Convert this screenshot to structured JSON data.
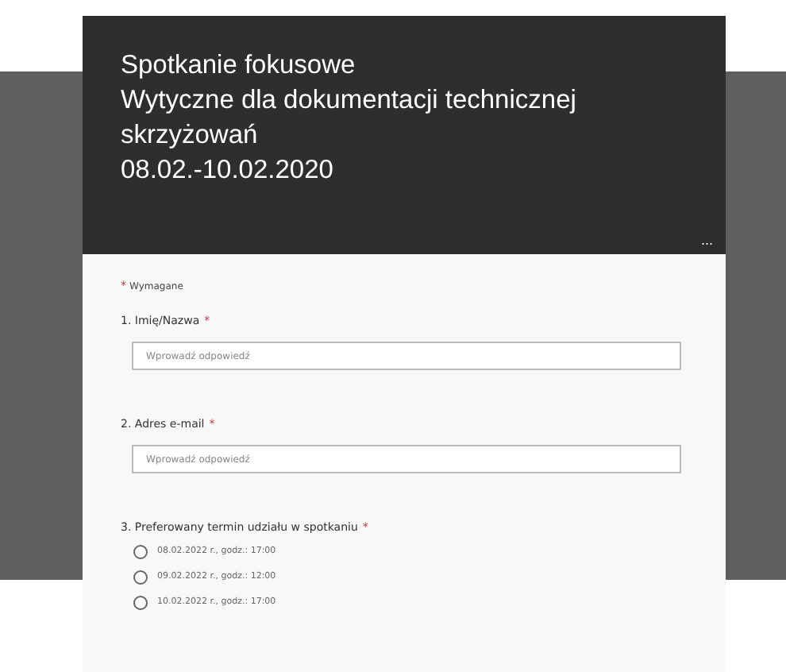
{
  "header": {
    "title_lines": [
      "Spotkanie fokusowe",
      "Wytyczne dla dokumentacji technicznej",
      "skrzyżowań",
      "08.02.-10.02.2020"
    ],
    "more": "..."
  },
  "required_note": {
    "mark": "*",
    "text": "Wymagane"
  },
  "questions": [
    {
      "kind": "text",
      "label": "1. Imię/Nazwa",
      "required": true,
      "placeholder": "Wprowadź odpowiedź"
    },
    {
      "kind": "text",
      "label": "2. Adres e-mail",
      "required": true,
      "placeholder": "Wprowadź odpowiedź"
    },
    {
      "kind": "radio",
      "label": "3. Preferowany termin udziału w spotkaniu",
      "required": true,
      "options": [
        {
          "label": "08.02.2022 r., godz.: 17:00",
          "selected": false
        },
        {
          "label": "09.02.2022 r., godz.: 12:00",
          "selected": false
        },
        {
          "label": "10.02.2022 r., godz.: 17:00",
          "selected": false
        }
      ]
    }
  ]
}
